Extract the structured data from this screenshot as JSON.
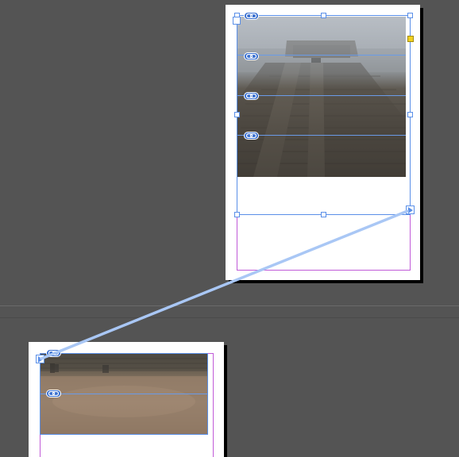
{
  "app": {
    "view": "layout-pasteboard"
  },
  "colors": {
    "pasteboard": "#545454",
    "page": "#ffffff",
    "frame_selection": "#5a8fe8",
    "margin_guide": "#c05ad8",
    "thread_line": "#a9c7f5",
    "link_badge": "#3a70d0",
    "content_grabber": "#f0d020"
  },
  "icons": {
    "link": "chain-link-icon",
    "out_port": "threaded-out-port-icon",
    "in_port": "threaded-in-port-icon"
  },
  "pages": [
    {
      "name": "top-page",
      "images": [
        {
          "name": "pyramid-photo",
          "description_visible": false
        }
      ],
      "link_badges": 4
    },
    {
      "name": "bottom-page",
      "images": [
        {
          "name": "field-photo",
          "description_visible": false
        }
      ],
      "link_badges": 2
    }
  ]
}
